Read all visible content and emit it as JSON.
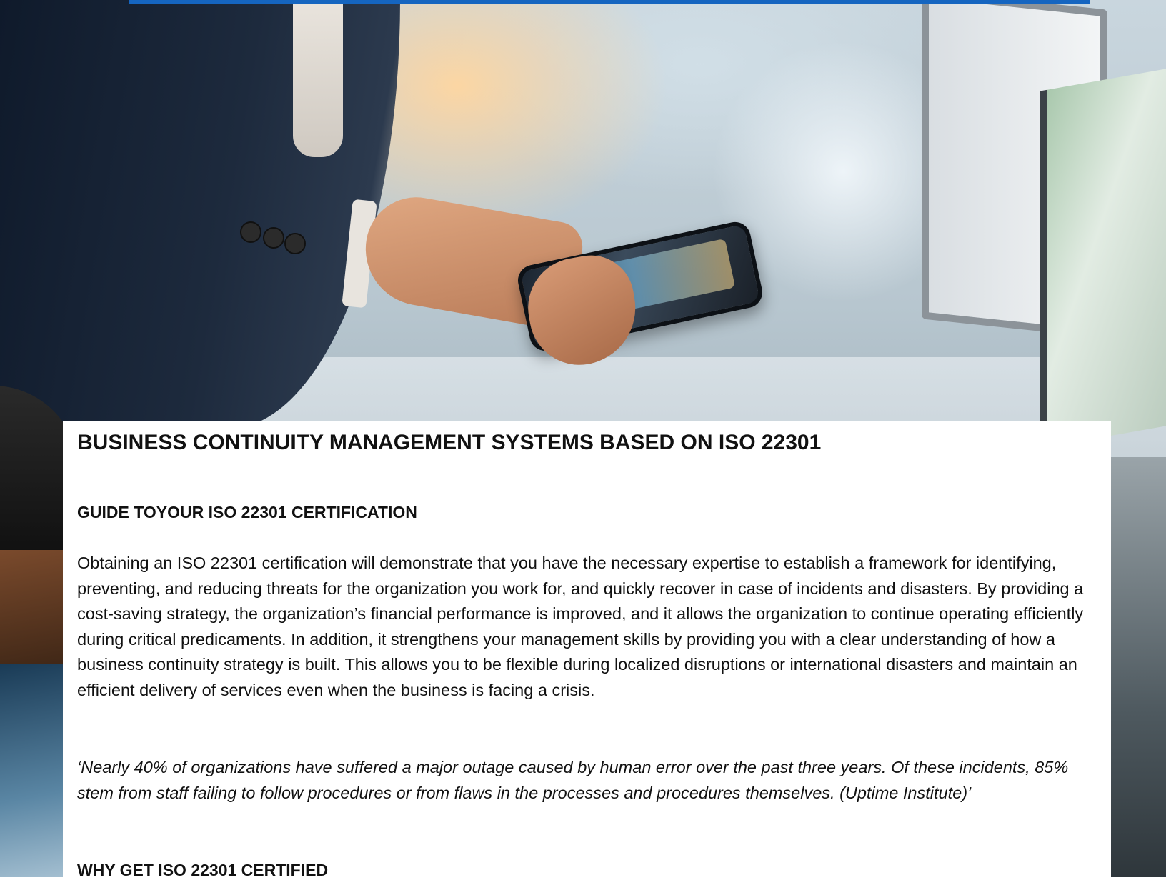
{
  "document": {
    "title": "BUSINESS CONTINUITY MANAGEMENT SYSTEMS BASED ON ISO 22301",
    "section_guide": {
      "heading": "GUIDE TOYOUR ISO 22301 CERTIFICATION",
      "body": "Obtaining an ISO 22301 certification will demonstrate that you have the necessary expertise to establish a framework for identifying, preventing, and reducing threats for the organization you work for, and quickly recover in case of incidents and disasters. By providing a cost-saving strategy, the organization’s financial performance is improved, and it allows the organization to continue operating efficiently during critical predicaments. In addition, it strengthens your management skills by providing you with a clear understanding of how a business continuity strategy is built. This allows you to be flexible during localized disruptions or international disasters and maintain an efficient delivery of services even when the business is facing a crisis."
    },
    "quote": "‘Nearly 40% of organizations have suffered a major outage caused by human error over the past three years. Of these incidents, 85% stem from staff failing to follow procedures or from flaws in the processes and procedures themselves. (Uptime Institute)’",
    "section_why": {
      "heading": "WHY GET ISO 22301 CERTIFIED"
    }
  },
  "colors": {
    "accent_bar": "#1565c0",
    "text": "#111111",
    "panel": "#ffffff"
  }
}
